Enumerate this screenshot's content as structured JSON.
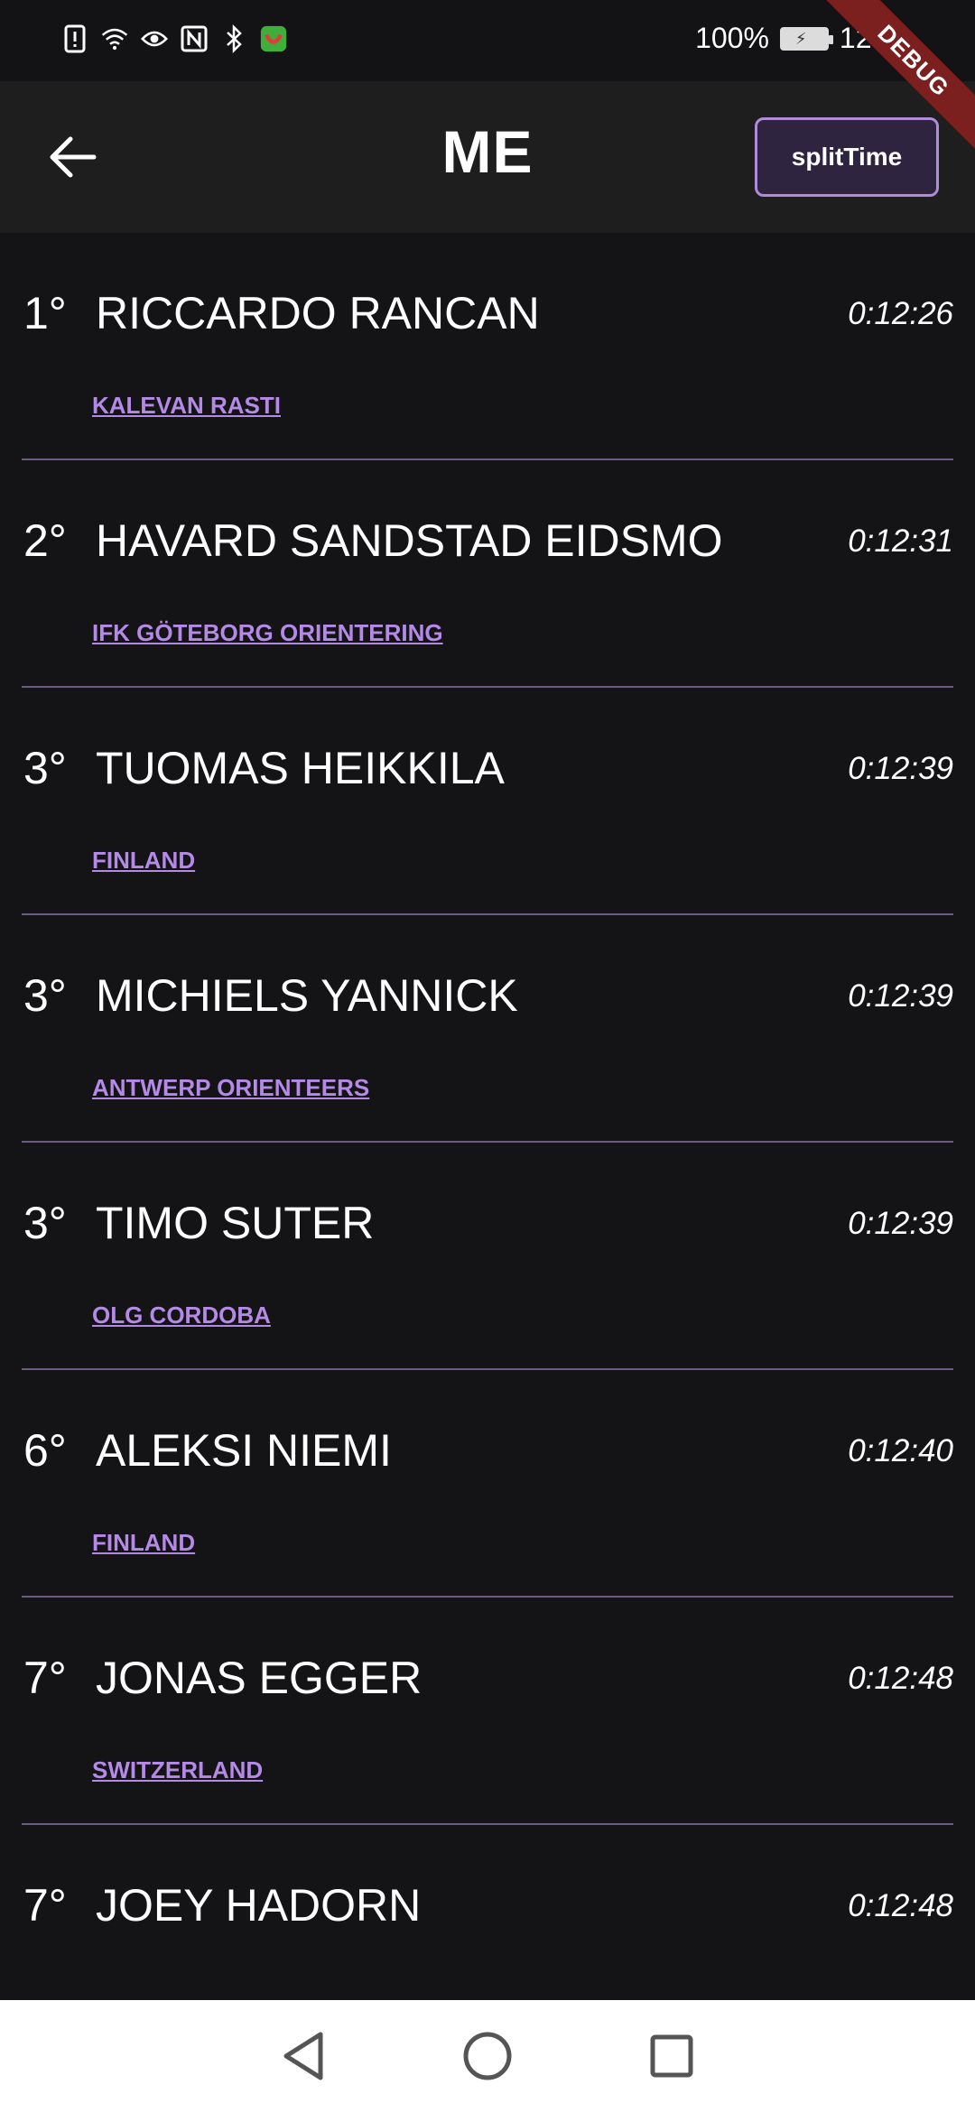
{
  "status_bar": {
    "battery_percent": "100%",
    "time": "12:50",
    "icons": [
      "alert-icon",
      "wifi-icon",
      "eye-icon",
      "nfc-icon",
      "bluetooth-icon",
      "app-icon"
    ]
  },
  "debug_banner": "DEBUG",
  "app_bar": {
    "title": "ME",
    "split_button_label": "splitTime",
    "back_icon": "arrow-left-icon"
  },
  "results": [
    {
      "rank": "1°",
      "name": "RICCARDO RANCAN",
      "time": "0:12:26",
      "club": "KALEVAN RASTI"
    },
    {
      "rank": "2°",
      "name": "HAVARD SANDSTAD EIDSMO",
      "time": "0:12:31",
      "club": "IFK GÖTEBORG ORIENTERING"
    },
    {
      "rank": "3°",
      "name": "TUOMAS HEIKKILA",
      "time": "0:12:39",
      "club": "FINLAND"
    },
    {
      "rank": "3°",
      "name": "MICHIELS YANNICK",
      "time": "0:12:39",
      "club": "ANTWERP ORIENTEERS"
    },
    {
      "rank": "3°",
      "name": "TIMO SUTER",
      "time": "0:12:39",
      "club": "OLG CORDOBA"
    },
    {
      "rank": "6°",
      "name": "ALEKSI NIEMI",
      "time": "0:12:40",
      "club": "FINLAND"
    },
    {
      "rank": "7°",
      "name": "JONAS EGGER",
      "time": "0:12:48",
      "club": "SWITZERLAND"
    },
    {
      "rank": "7°",
      "name": "JOEY HADORN",
      "time": "0:12:48",
      "club": ""
    }
  ],
  "colors": {
    "background": "#141316",
    "app_bar": "#1e1e1f",
    "accent": "#b48ae6",
    "divider": "#6c5a85",
    "debug_ribbon": "#7b1f1f"
  }
}
